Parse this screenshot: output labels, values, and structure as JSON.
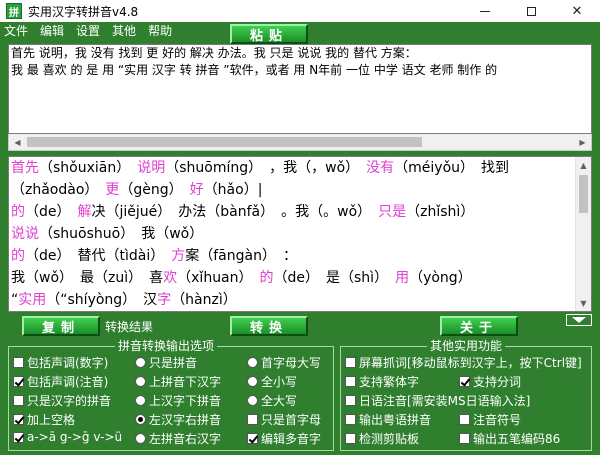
{
  "window": {
    "title": "实用汉字转拼音v4.8",
    "app_icon": "拼"
  },
  "menu": [
    "文件",
    "编辑",
    "设置",
    "其他",
    "帮助"
  ],
  "buttons": {
    "paste": "粘贴",
    "copy": "复制",
    "convert": "转换",
    "about": "关于"
  },
  "input_text": {
    "lines": [
      "首先 说明，我 没有 找到 更 好的 解决 办法。我 只是 说说 我的 替代 方案：",
      "我 最 喜欢 的 是 用 “实用 汉字 转 拼音 ”软件，或者 用 N年前 一位 中学 语文 老师 制作 的"
    ]
  },
  "result_label": "转换结果",
  "result_lines": [
    [
      {
        "hz": "首先",
        "py": "（shǒuxiān）"
      },
      {
        "t": "　"
      },
      {
        "hz": "说明",
        "py": "（shuōmíng）"
      },
      {
        "t": "　，我（，wǒ）　"
      },
      {
        "hz": "没有",
        "py": "（méiyǒu）"
      },
      {
        "t": "　找到"
      }
    ],
    [
      {
        "t": "（zhǎodào）　"
      },
      {
        "hz": "更",
        "py": "（gèng）"
      },
      {
        "t": "　"
      },
      {
        "hz": "好",
        "py": "（hǎo）"
      },
      {
        "t": "|"
      }
    ],
    [
      {
        "hz": "的",
        "py": "（de）"
      },
      {
        "t": "　"
      },
      {
        "hz": "解",
        "py": "决（jiějué）"
      },
      {
        "t": "　办法（bànfǎ）　。我（。wǒ）　"
      },
      {
        "hz": "只是",
        "py": "（zhǐshì）"
      }
    ],
    [
      {
        "hz": "说说",
        "py": "（shuōshuō）"
      },
      {
        "t": "　我（wǒ）"
      }
    ],
    [
      {
        "hz": "的",
        "py": "（de）"
      },
      {
        "t": "　替代（tìdài）　"
      },
      {
        "hz": "方",
        "py": "案（fāngàn）"
      },
      {
        "t": "　："
      }
    ],
    [
      {
        "t": "我（wǒ）　最（zuì）　喜"
      },
      {
        "hz": "欢",
        "py": "（xǐhuan）"
      },
      {
        "t": "　"
      },
      {
        "hz": "的",
        "py": "（de）"
      },
      {
        "t": "　是（shì）　"
      },
      {
        "hz": "用",
        "py": "（yòng）"
      }
    ],
    [
      {
        "t": "“"
      },
      {
        "hz": "实用",
        "py": "（“shíyòng）"
      },
      {
        "t": "　汉"
      },
      {
        "hz": "字",
        "py": "（hànzì）"
      }
    ]
  ],
  "pinyin_group": {
    "title": "拼音转换输出选项",
    "options": [
      {
        "label": "包括声调(数字)",
        "kind": "checkbox",
        "checked": false
      },
      {
        "label": "只是拼音",
        "kind": "radio",
        "checked": false
      },
      {
        "label": "首字母大写",
        "kind": "radio",
        "checked": false
      },
      {
        "label": "包括声调(注音)",
        "kind": "checkbox",
        "checked": true
      },
      {
        "label": "上拼音下汉字",
        "kind": "radio",
        "checked": false
      },
      {
        "label": "全小写",
        "kind": "radio",
        "checked": false
      },
      {
        "label": "只是汉字的拼音",
        "kind": "checkbox",
        "checked": false
      },
      {
        "label": "上汉字下拼音",
        "kind": "radio",
        "checked": false
      },
      {
        "label": "全大写",
        "kind": "radio",
        "checked": false
      },
      {
        "label": "加上空格",
        "kind": "checkbox",
        "checked": true
      },
      {
        "label": "左汉字右拼音",
        "kind": "radio",
        "checked": true
      },
      {
        "label": "只是首字母",
        "kind": "checkbox",
        "checked": false
      },
      {
        "label": "a->ā g->ḡ v->ü",
        "kind": "checkbox",
        "checked": true
      },
      {
        "label": "左拼音右汉字",
        "kind": "radio",
        "checked": false
      },
      {
        "label": "编辑多音字",
        "kind": "checkbox",
        "checked": true
      }
    ]
  },
  "other_group": {
    "title": "其他实用功能",
    "options": [
      {
        "label": "屏幕抓词[移动鼠标到汉字上，按下Ctrl键]",
        "kind": "checkbox",
        "checked": false
      },
      {
        "label": "支持繁体字",
        "kind": "checkbox",
        "checked": false
      },
      {
        "label": "支持分词",
        "kind": "checkbox",
        "checked": true
      },
      {
        "label": "日语注音[需安装MS日语输入法]",
        "kind": "checkbox",
        "checked": false
      },
      {
        "label": "输出粤语拼音",
        "kind": "checkbox",
        "checked": false
      },
      {
        "label": "注音符号",
        "kind": "checkbox",
        "checked": false
      },
      {
        "label": "检测剪贴板",
        "kind": "checkbox",
        "checked": false
      },
      {
        "label": "输出五笔编码86",
        "kind": "checkbox",
        "checked": false
      }
    ]
  },
  "colors": {
    "background": "#2f7f2f",
    "highlight": "#e040d0"
  }
}
